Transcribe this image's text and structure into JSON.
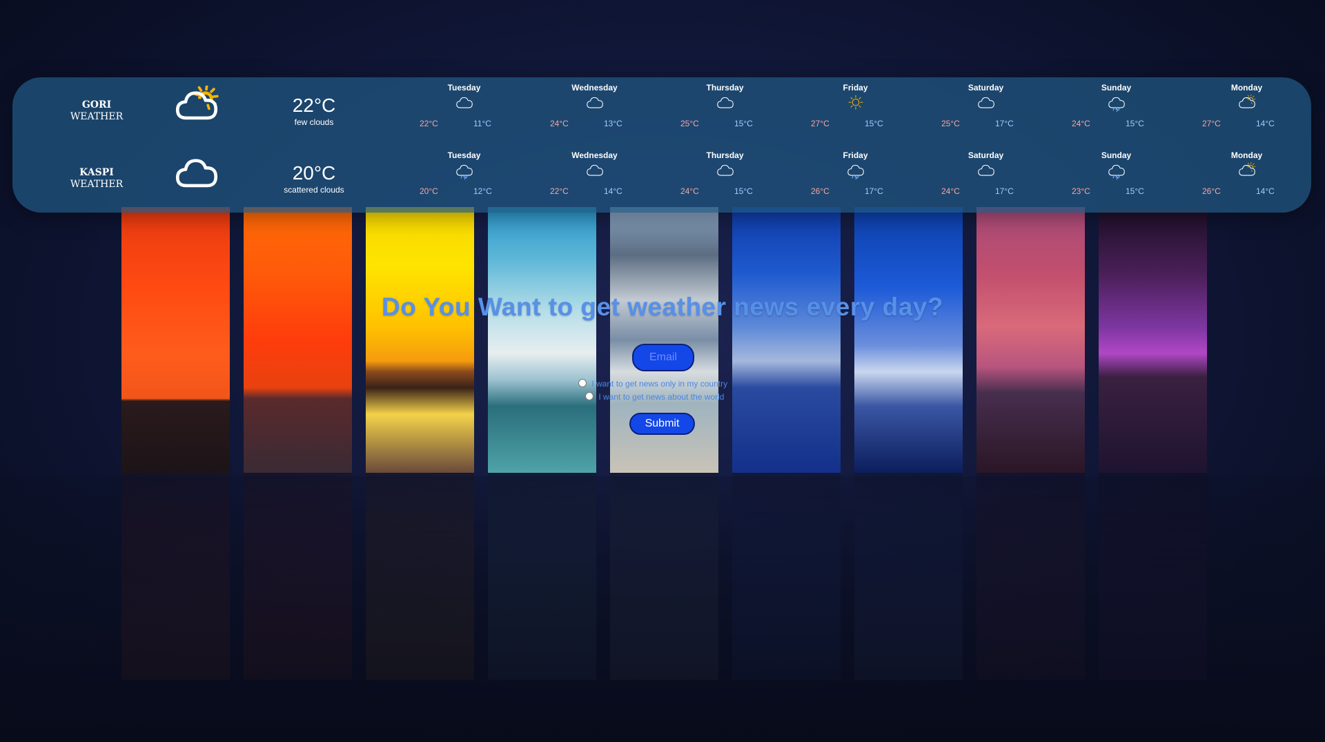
{
  "cities": [
    {
      "name": "GORI",
      "label": "WEATHER",
      "current": {
        "temp": "22°C",
        "desc": "few clouds",
        "icon": "sun-cloud-icon"
      },
      "forecast": [
        {
          "day": "Tuesday",
          "icon": "cloud-icon",
          "max": "22°C",
          "min": "11°C"
        },
        {
          "day": "Wednesday",
          "icon": "cloud-icon",
          "max": "24°C",
          "min": "13°C"
        },
        {
          "day": "Thursday",
          "icon": "cloud-icon",
          "max": "25°C",
          "min": "15°C"
        },
        {
          "day": "Friday",
          "icon": "sun-icon",
          "max": "27°C",
          "min": "15°C"
        },
        {
          "day": "Saturday",
          "icon": "cloud-icon",
          "max": "25°C",
          "min": "17°C"
        },
        {
          "day": "Sunday",
          "icon": "rain-cloud-icon",
          "max": "24°C",
          "min": "15°C"
        },
        {
          "day": "Monday",
          "icon": "sun-cloud-icon",
          "max": "27°C",
          "min": "14°C"
        }
      ]
    },
    {
      "name": "KASPI",
      "label": "WEATHER",
      "current": {
        "temp": "20°C",
        "desc": "scattered clouds",
        "icon": "cloud-icon"
      },
      "forecast": [
        {
          "day": "Tuesday",
          "icon": "rain-cloud-icon",
          "max": "20°C",
          "min": "12°C"
        },
        {
          "day": "Wednesday",
          "icon": "cloud-icon",
          "max": "22°C",
          "min": "14°C"
        },
        {
          "day": "Thursday",
          "icon": "cloud-icon",
          "max": "24°C",
          "min": "15°C"
        },
        {
          "day": "Friday",
          "icon": "rain-cloud-icon",
          "max": "26°C",
          "min": "17°C"
        },
        {
          "day": "Saturday",
          "icon": "cloud-icon",
          "max": "24°C",
          "min": "17°C"
        },
        {
          "day": "Sunday",
          "icon": "rain-cloud-icon",
          "max": "23°C",
          "min": "15°C"
        },
        {
          "day": "Monday",
          "icon": "sun-cloud-icon",
          "max": "26°C",
          "min": "14°C"
        }
      ]
    }
  ],
  "newsletter": {
    "headline": "Do You Want to get weather news every day?",
    "email_placeholder": "Email",
    "options": [
      "I want to get news only in my country",
      "I want to get news about the world"
    ],
    "submit_label": "Submit"
  },
  "colors": {
    "panel": "#215680",
    "max_temp": "#f7a6a1",
    "min_temp": "#a8c9ff",
    "headline": "#5790e8",
    "button": "#1447e8"
  }
}
